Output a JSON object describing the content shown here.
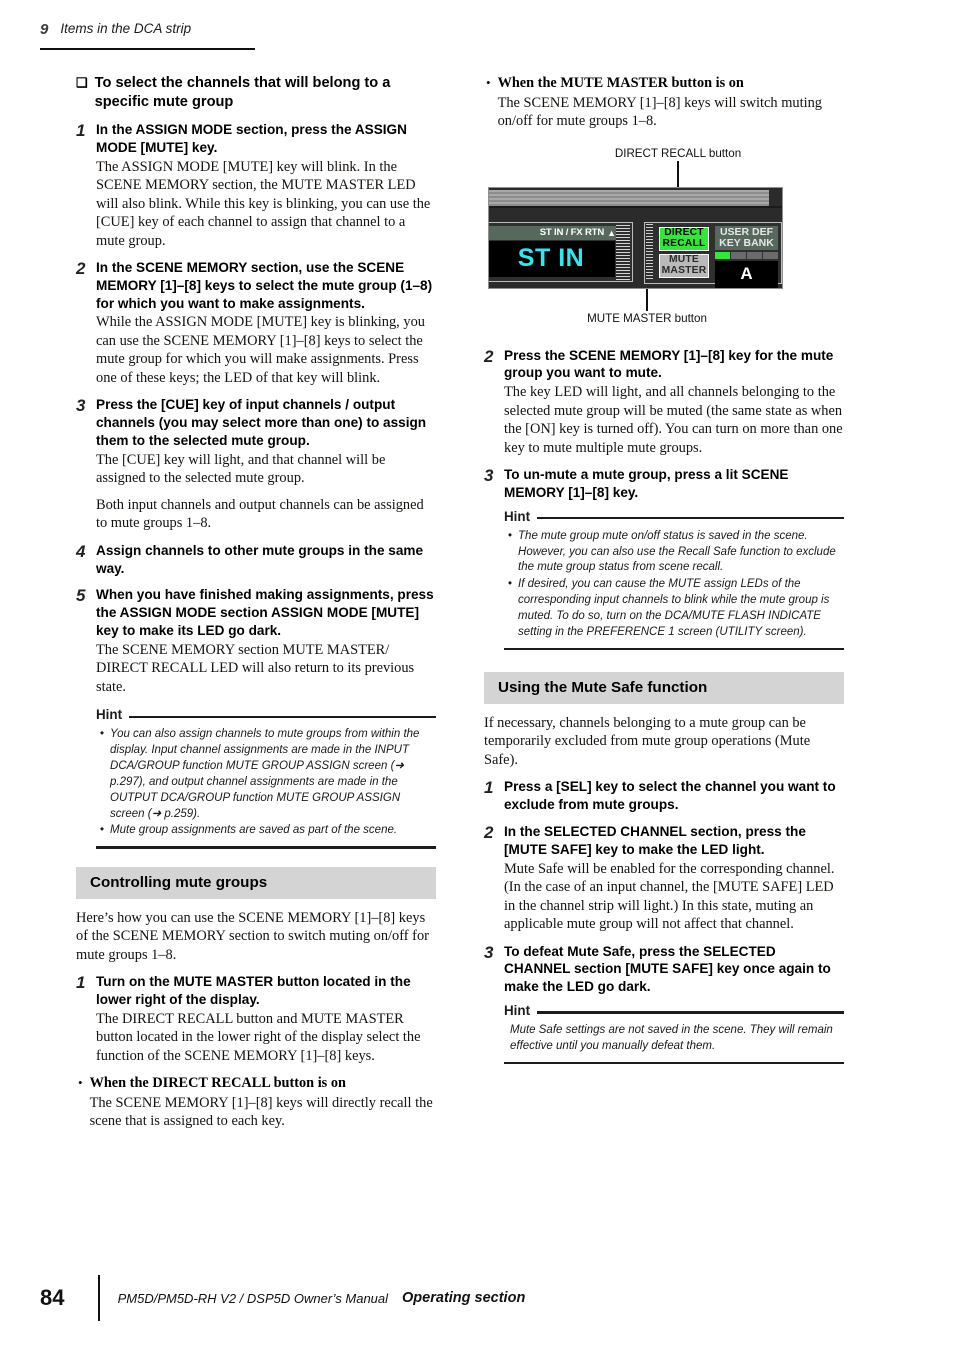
{
  "running_head": {
    "chapter_number": "9",
    "chapter_title": "Items in the DCA strip"
  },
  "left_column": {
    "procedure_heading": "To select the channels that will belong to a specific mute group",
    "bullet_glyph": "❑",
    "steps": [
      {
        "num": "1",
        "title": "In the ASSIGN MODE section, press the ASSIGN MODE [MUTE] key.",
        "paragraphs": [
          "The ASSIGN MODE [MUTE] key will blink. In the SCENE MEMORY section, the MUTE MASTER LED will also blink. While this key is blinking, you can use the [CUE] key of each channel to assign that channel to a mute group."
        ]
      },
      {
        "num": "2",
        "title": "In the SCENE MEMORY section, use the SCENE MEMORY [1]–[8] keys to select the mute group (1–8) for which you want to make assignments.",
        "paragraphs": [
          "While the ASSIGN MODE [MUTE] key is blinking, you can use the SCENE MEMORY [1]–[8] keys to select the mute group for which you will make assignments. Press one of these keys; the LED of that key will blink."
        ]
      },
      {
        "num": "3",
        "title": "Press the [CUE] key of input channels / output channels (you may select more than one) to assign them to the selected mute group.",
        "paragraphs": [
          "The [CUE] key will light, and that channel will be assigned to the selected mute group.",
          "Both input channels and output channels can be assigned to mute groups 1–8."
        ]
      },
      {
        "num": "4",
        "title": "Assign channels to other mute groups in the same way.",
        "paragraphs": []
      },
      {
        "num": "5",
        "title": "When you have finished making assignments, press the ASSIGN MODE section ASSIGN MODE [MUTE] key to make its LED go dark.",
        "paragraphs": [
          "The SCENE MEMORY section MUTE MASTER/ DIRECT RECALL LED will also return to its previous state."
        ]
      }
    ],
    "hint": {
      "label": "Hint",
      "items": [
        "You can also assign channels to mute groups from within the display. Input channel assignments are made in the INPUT DCA/GROUP function MUTE GROUP ASSIGN screen (➜ p.297), and output channel assignments are made in the OUTPUT DCA/GROUP function MUTE GROUP ASSIGN screen (➜ p.259).",
        "Mute group assignments are saved as part of the scene."
      ]
    },
    "section_controlling": {
      "heading": "Controlling mute groups",
      "intro": "Here’s how you can use the SCENE MEMORY [1]–[8] keys of the SCENE MEMORY section to switch muting on/off for mute groups 1–8.",
      "steps": [
        {
          "num": "1",
          "title": "Turn on the MUTE MASTER button located in the lower right of the display.",
          "paragraphs": [
            "The DIRECT RECALL button and MUTE MASTER button located in the lower right of the display select the function of the SCENE MEMORY [1]–[8] keys."
          ]
        }
      ],
      "sub_bullets": [
        {
          "title": "When the DIRECT RECALL button is on",
          "text": "The SCENE MEMORY [1]–[8] keys will directly recall the scene that is assigned to each key."
        }
      ]
    }
  },
  "right_column": {
    "sub_bullets_top": [
      {
        "title": "When the MUTE MASTER button is on",
        "text": "The SCENE MEMORY [1]–[8] keys will switch muting on/off for mute groups 1–8."
      }
    ],
    "figure": {
      "caption_top": "DIRECT RECALL button",
      "caption_bottom": "MUTE MASTER button",
      "lcd": {
        "tab_label": "ST IN / FX RTN",
        "tab_arrow_icon": "up-triangle-icon",
        "display_text": "ST IN",
        "display_text_color": "#2ee8f2",
        "direct_recall_label_line1": "DIRECT",
        "direct_recall_label_line2": "RECALL",
        "direct_recall_on_color": "#31e83a",
        "mute_master_label_line1": "MUTE",
        "mute_master_label_line2": "MASTER",
        "mute_master_off_color": "#b9b9b9",
        "user_def_title_line1": "USER DEF",
        "user_def_title_line2": "KEY BANK",
        "user_def_leds": [
          "on",
          "off",
          "off",
          "off"
        ],
        "user_def_bank": "A"
      }
    },
    "steps": [
      {
        "num": "2",
        "title": "Press the SCENE MEMORY [1]–[8] key for the mute group you want to mute.",
        "paragraphs": [
          "The key LED will light, and all channels belonging to the selected mute group will be muted (the same state as when the [ON] key is turned off). You can turn on more than one key to mute multiple mute groups."
        ]
      },
      {
        "num": "3",
        "title": "To un-mute a mute group, press a lit SCENE MEMORY [1]–[8] key.",
        "paragraphs": []
      }
    ],
    "hint_1": {
      "label": "Hint",
      "items": [
        "The mute group mute on/off status is saved in the scene. However, you can also use the Recall Safe function to exclude the mute group status from scene recall.",
        "If desired, you can cause the MUTE assign LEDs of the corresponding input channels to blink while the mute group is muted. To do so, turn on the DCA/MUTE FLASH INDICATE setting in the PREFERENCE 1 screen (UTILITY screen)."
      ]
    },
    "section_mute_safe": {
      "heading": "Using the Mute Safe function",
      "intro": "If necessary, channels belonging to a mute group can be temporarily excluded from mute group operations (Mute Safe).",
      "steps": [
        {
          "num": "1",
          "title": "Press a [SEL] key to select the channel you want to exclude from mute groups.",
          "paragraphs": []
        },
        {
          "num": "2",
          "title": "In the SELECTED CHANNEL section, press the [MUTE SAFE] key to make the LED light.",
          "paragraphs": [
            "Mute Safe will be enabled for the corresponding channel. (In the case of an input channel, the [MUTE SAFE] LED in the channel strip will light.) In this state, muting an applicable mute group will not affect that channel."
          ]
        },
        {
          "num": "3",
          "title": "To defeat Mute Safe, press the SELECTED CHANNEL section [MUTE SAFE] key once again to make the LED go dark.",
          "paragraphs": []
        }
      ],
      "hint": {
        "label": "Hint",
        "text": "Mute Safe settings are not saved in the scene. They will remain effective until you manually defeat them."
      }
    }
  },
  "footer": {
    "page_number": "84",
    "manual_title": "PM5D/PM5D-RH V2 / DSP5D Owner’s Manual",
    "section_name": "Operating section"
  }
}
